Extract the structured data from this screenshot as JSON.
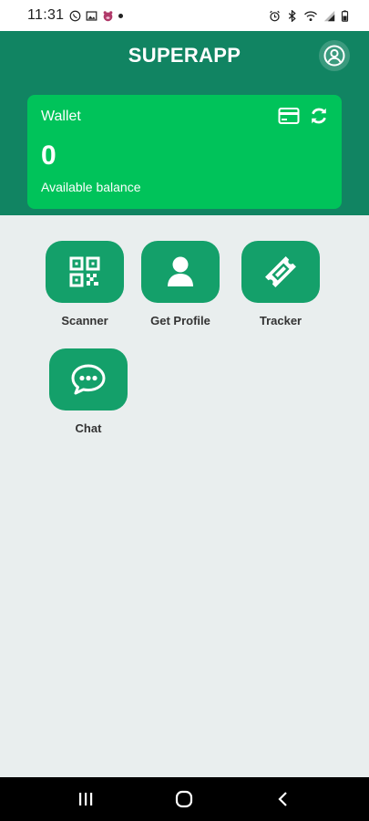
{
  "status_bar": {
    "time": "11:31",
    "left_icons": [
      "viber-icon",
      "gallery-icon",
      "pig-icon",
      "dot-icon"
    ],
    "right_icons": [
      "alarm-icon",
      "bluetooth-icon",
      "wifi-icon",
      "signal-icon",
      "battery-icon"
    ]
  },
  "header": {
    "title": "SUPERAPP",
    "profile_icon": "account-circle-icon"
  },
  "wallet": {
    "title": "Wallet",
    "balance": "0",
    "caption": "Available balance",
    "icons": [
      "card-icon",
      "refresh-icon"
    ]
  },
  "tiles": [
    {
      "label": "Scanner",
      "icon": "qr-code-icon"
    },
    {
      "label": "Get Profile",
      "icon": "person-icon"
    },
    {
      "label": "Tracker",
      "icon": "ticket-icon"
    },
    {
      "label": "Chat",
      "icon": "chat-bubble-icon"
    }
  ],
  "nav_bar": {
    "items": [
      "recents-icon",
      "home-icon",
      "back-icon"
    ]
  },
  "colors": {
    "header_bg": "#118462",
    "wallet_bg": "#00c35a",
    "tile_bg": "#14a06a",
    "page_bg": "#e9eeee"
  }
}
